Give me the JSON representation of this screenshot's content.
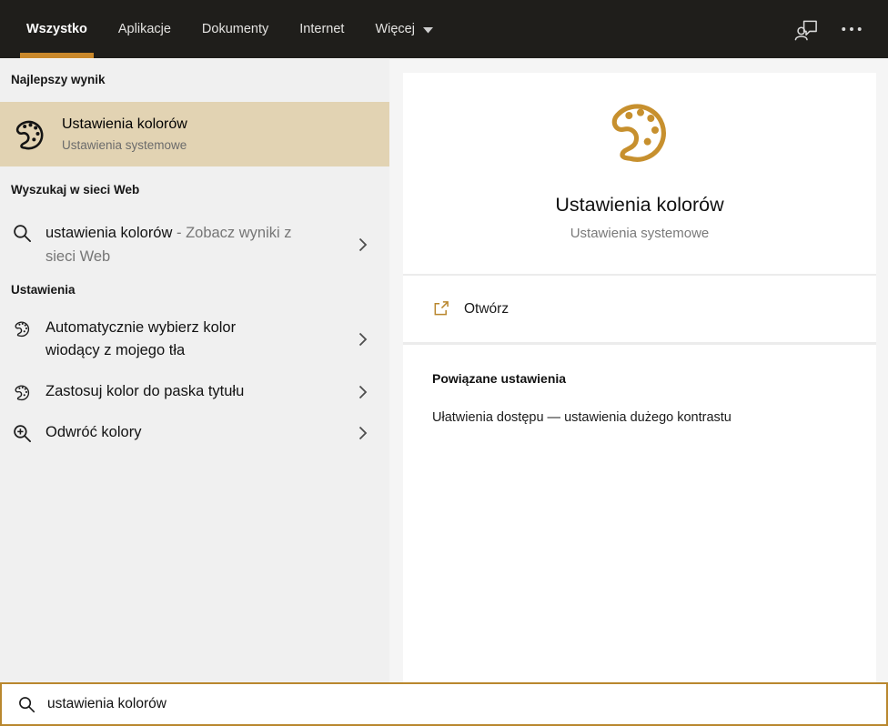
{
  "colors": {
    "accent_gold": "#c7902e",
    "tab_underline": "#c9882b",
    "selection_bg": "#e2d3b3",
    "topbar_bg": "#1f1e1b",
    "search_border": "#b9872e"
  },
  "topbar": {
    "tabs": [
      {
        "label": "Wszystko",
        "active": true
      },
      {
        "label": "Aplikacje",
        "active": false
      },
      {
        "label": "Dokumenty",
        "active": false
      },
      {
        "label": "Internet",
        "active": false
      },
      {
        "label": "Więcej",
        "active": false,
        "has_dropdown": true
      }
    ],
    "icons": [
      "feedback-icon",
      "more-options-icon"
    ]
  },
  "left_panel": {
    "best_match": {
      "header": "Najlepszy wynik",
      "item": {
        "title": "Ustawienia kolorów",
        "subtitle": "Ustawienia systemowe",
        "icon": "palette-icon"
      }
    },
    "web_search": {
      "header": "Wyszukaj w sieci Web",
      "item": {
        "query": "ustawienia kolorów",
        "suffix": " - Zobacz wyniki z sieci Web",
        "icon": "search-icon"
      }
    },
    "settings": {
      "header": "Ustawienia",
      "items": [
        {
          "label": "Automatycznie wybierz kolor wiodący z mojego tła",
          "icon": "palette-icon"
        },
        {
          "label": "Zastosuj kolor do paska tytułu",
          "icon": "palette-icon"
        },
        {
          "label": "Odwróć kolory",
          "icon": "zoom-in-icon"
        }
      ]
    }
  },
  "preview_panel": {
    "title": "Ustawienia kolorów",
    "subtitle": "Ustawienia systemowe",
    "icon": "palette-icon",
    "open_action": {
      "label": "Otwórz",
      "icon": "open-external-icon"
    },
    "related": {
      "header": "Powiązane ustawienia",
      "items": [
        "Ułatwienia dostępu — ustawienia dużego kontrastu"
      ]
    }
  },
  "search_bar": {
    "value": "ustawienia kolorów",
    "icon": "search-icon"
  }
}
